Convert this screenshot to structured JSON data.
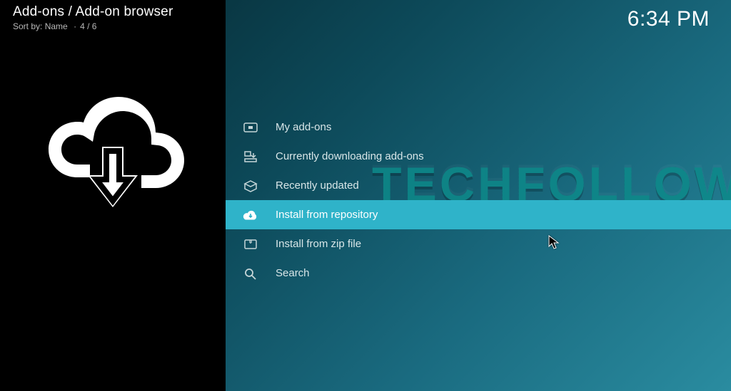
{
  "header": {
    "title": "Add-ons / Add-on browser",
    "sort_label": "Sort by:",
    "sort_value": "Name",
    "counter": "4 / 6"
  },
  "clock": "6:34 PM",
  "watermark": "TECHFOLLOWS",
  "menu": {
    "items": [
      {
        "icon": "addons-icon",
        "label": "My add-ons"
      },
      {
        "icon": "download-icon",
        "label": "Currently downloading add-ons"
      },
      {
        "icon": "package-icon",
        "label": "Recently updated"
      },
      {
        "icon": "cloud-install-icon",
        "label": "Install from repository"
      },
      {
        "icon": "zip-icon",
        "label": "Install from zip file"
      },
      {
        "icon": "search-icon",
        "label": "Search"
      }
    ],
    "selected_index": 3
  }
}
